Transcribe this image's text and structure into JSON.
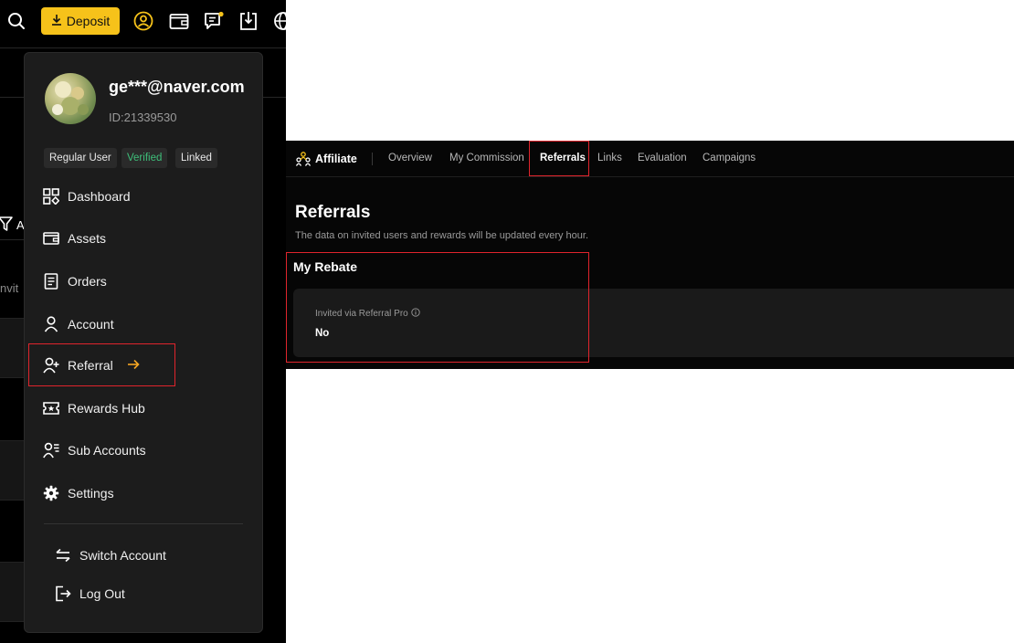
{
  "topbar": {
    "deposit_label": "Deposit",
    "accent_color": "#f6c21a"
  },
  "background": {
    "partial_button_text": "A",
    "partial_text": "nvit"
  },
  "user": {
    "email": "ge***@naver.com",
    "id": "ID:21339530",
    "badges": [
      {
        "label": "Regular User",
        "color": "#e8e8e8"
      },
      {
        "label": "Verified",
        "color": "#3ebf7a"
      },
      {
        "label": "Linked",
        "color": "#e8e8e8"
      }
    ]
  },
  "menu": {
    "items": [
      {
        "label": "Dashboard",
        "icon": "dashboard-icon"
      },
      {
        "label": "Assets",
        "icon": "wallet-icon"
      },
      {
        "label": "Orders",
        "icon": "orders-icon"
      },
      {
        "label": "Account",
        "icon": "person-icon"
      },
      {
        "label": "Referral",
        "icon": "add-user-icon",
        "selected": true,
        "arrow_color": "#f6a623"
      },
      {
        "label": "Rewards Hub",
        "icon": "ticket-icon"
      },
      {
        "label": "Sub Accounts",
        "icon": "sub-accounts-icon"
      },
      {
        "label": "Settings",
        "icon": "gear-icon"
      }
    ],
    "bottom_items": [
      {
        "label": "Switch Account",
        "icon": "switch-icon"
      },
      {
        "label": "Log Out",
        "icon": "logout-icon"
      }
    ]
  },
  "affiliate": {
    "brand": "Affiliate",
    "tabs": [
      {
        "label": "Overview"
      },
      {
        "label": "My Commission"
      },
      {
        "label": "Referrals",
        "active": true
      },
      {
        "label": "Links"
      },
      {
        "label": "Evaluation"
      },
      {
        "label": "Campaigns"
      }
    ],
    "page_title": "Referrals",
    "description": "The data on invited users and rewards will be updated every hour.",
    "rebate": {
      "title": "My Rebate",
      "label": "Invited via Referral Pro",
      "value": "No"
    }
  },
  "highlight_color": "#e0242c"
}
